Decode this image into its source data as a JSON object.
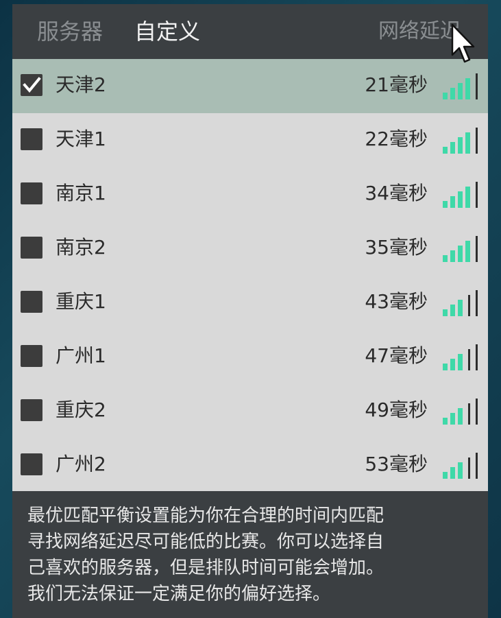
{
  "tabs": {
    "servers": "服务器",
    "custom": "自定义"
  },
  "ping_header": "网络延迟",
  "servers": [
    {
      "name": "天津2",
      "ping": "21毫秒",
      "checked": true,
      "bars": 4
    },
    {
      "name": "天津1",
      "ping": "22毫秒",
      "checked": false,
      "bars": 4
    },
    {
      "name": "南京1",
      "ping": "34毫秒",
      "checked": false,
      "bars": 4
    },
    {
      "name": "南京2",
      "ping": "35毫秒",
      "checked": false,
      "bars": 4
    },
    {
      "name": "重庆1",
      "ping": "43毫秒",
      "checked": false,
      "bars": 3
    },
    {
      "name": "广州1",
      "ping": "47毫秒",
      "checked": false,
      "bars": 3
    },
    {
      "name": "重庆2",
      "ping": "49毫秒",
      "checked": false,
      "bars": 3
    },
    {
      "name": "广州2",
      "ping": "53毫秒",
      "checked": false,
      "bars": 3
    }
  ],
  "info_lines": [
    "最优匹配平衡设置能为你在合理的时间内匹配",
    "寻找网络延迟尽可能低的比赛。你可以选择自",
    "己喜欢的服务器，但是排队时间可能会增加。",
    "我们无法保证一定满足你的偏好选择。"
  ],
  "colors": {
    "signal_active": "#3fd9a8",
    "signal_inactive": "#2d2d2d",
    "selected_row": "#a9bdb4",
    "row": "#d9d9d9",
    "panel": "#3b3f42"
  }
}
